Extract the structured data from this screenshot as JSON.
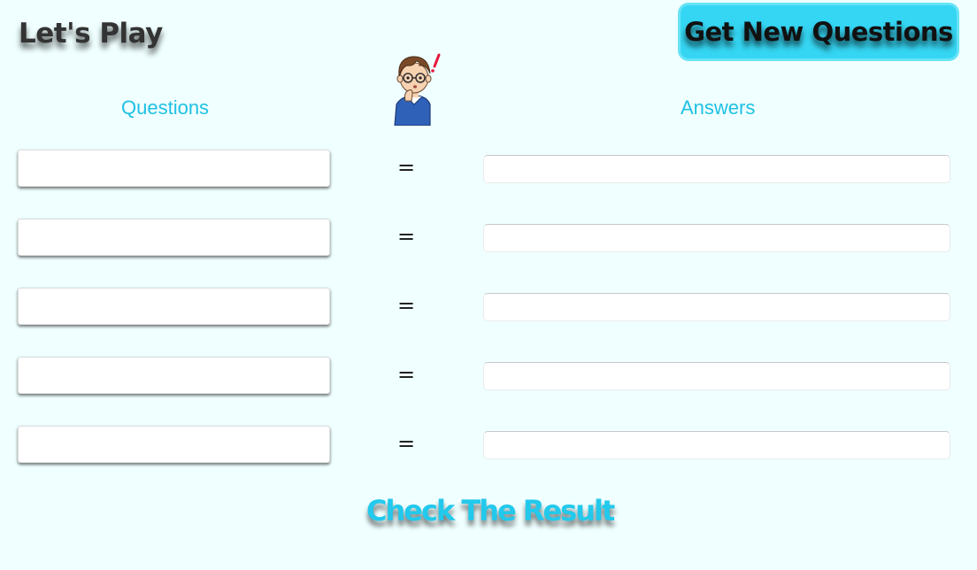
{
  "header": {
    "title": "Let's Play",
    "new_questions_label": "Get New Questions"
  },
  "mascot": {
    "icon": "thinking-boy-icon"
  },
  "columns": {
    "questions_label": "Questions",
    "answers_label": "Answers"
  },
  "rows": [
    {
      "question": "",
      "equals": "=",
      "answer": ""
    },
    {
      "question": "",
      "equals": "=",
      "answer": ""
    },
    {
      "question": "",
      "equals": "=",
      "answer": ""
    },
    {
      "question": "",
      "equals": "=",
      "answer": ""
    },
    {
      "question": "",
      "equals": "=",
      "answer": ""
    }
  ],
  "footer": {
    "check_label": "Check The Result"
  },
  "colors": {
    "background": "#f0ffff",
    "accent": "#22c9ec",
    "button": "#35d6f3"
  }
}
